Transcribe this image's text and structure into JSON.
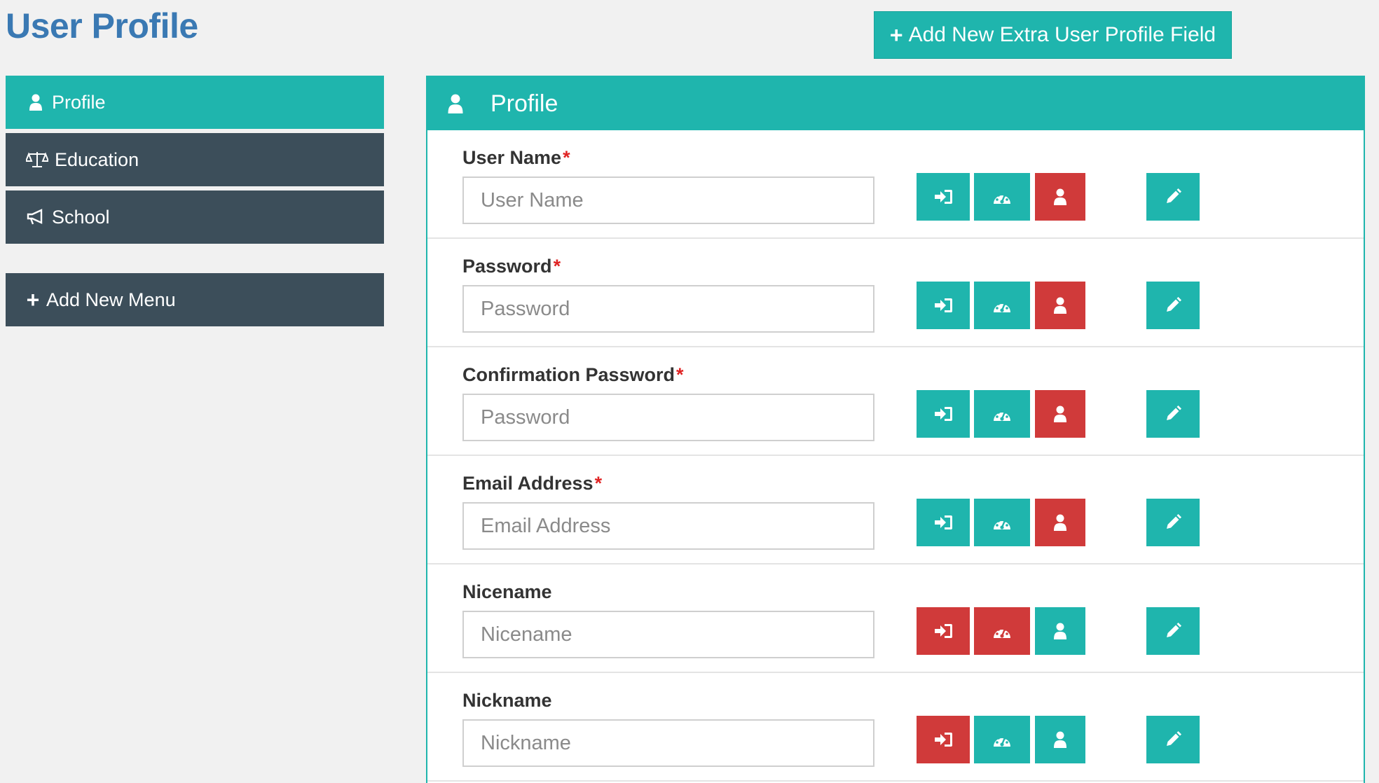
{
  "page": {
    "title": "User Profile"
  },
  "toolbar": {
    "add_field_label": "Add New Extra User Profile Field",
    "add_field_icon": "plus-icon"
  },
  "sidebar": {
    "items": [
      {
        "label": "Profile",
        "icon": "user-icon",
        "active": true
      },
      {
        "label": "Education",
        "icon": "balance-scale-icon",
        "active": false
      },
      {
        "label": "School",
        "icon": "bullhorn-icon",
        "active": false
      }
    ],
    "add_menu_label": "Add New Menu"
  },
  "panel": {
    "title": "Profile",
    "icon": "user-icon",
    "fields": [
      {
        "label": "User Name",
        "required": true,
        "placeholder": "User Name",
        "states": [
          "teal",
          "teal",
          "red"
        ]
      },
      {
        "label": "Password",
        "required": true,
        "placeholder": "Password",
        "states": [
          "teal",
          "teal",
          "red"
        ]
      },
      {
        "label": "Confirmation Password",
        "required": true,
        "placeholder": "Password",
        "states": [
          "teal",
          "teal",
          "red"
        ]
      },
      {
        "label": "Email Address",
        "required": true,
        "placeholder": "Email Address",
        "states": [
          "teal",
          "teal",
          "red"
        ]
      },
      {
        "label": "Nicename",
        "required": false,
        "placeholder": "Nicename",
        "states": [
          "red",
          "red",
          "teal"
        ]
      },
      {
        "label": "Nickname",
        "required": false,
        "placeholder": "Nickname",
        "states": [
          "red",
          "teal",
          "teal"
        ]
      }
    ],
    "required_marker": "*"
  },
  "colors": {
    "accent": "#1fb5ad",
    "danger": "#d03a3a",
    "sidebar_dark": "#3c4e5a",
    "title_blue": "#3a79b3"
  }
}
